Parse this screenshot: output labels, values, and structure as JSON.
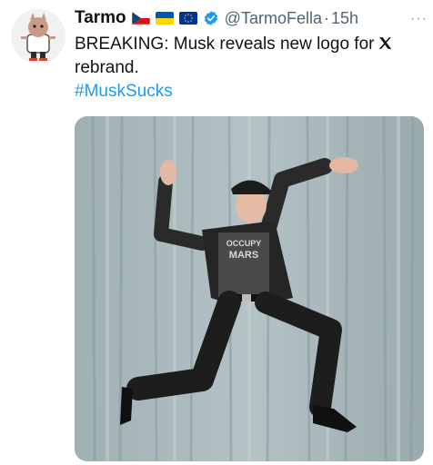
{
  "tweet": {
    "display_name": "Tarmo",
    "handle": "@TarmoFella",
    "separator": "·",
    "time": "15h",
    "more": "···",
    "text": "BREAKING: Musk reveals new logo for",
    "text_end": "rebrand.",
    "hashtag": "#MuskSucks",
    "flags": [
      "czech-flag-icon",
      "ukraine-flag-icon",
      "eu-flag-icon"
    ],
    "verified_color": "#1d9bf0"
  },
  "photo": {
    "shirt_text": [
      "OCCUPY",
      "MARS"
    ]
  }
}
